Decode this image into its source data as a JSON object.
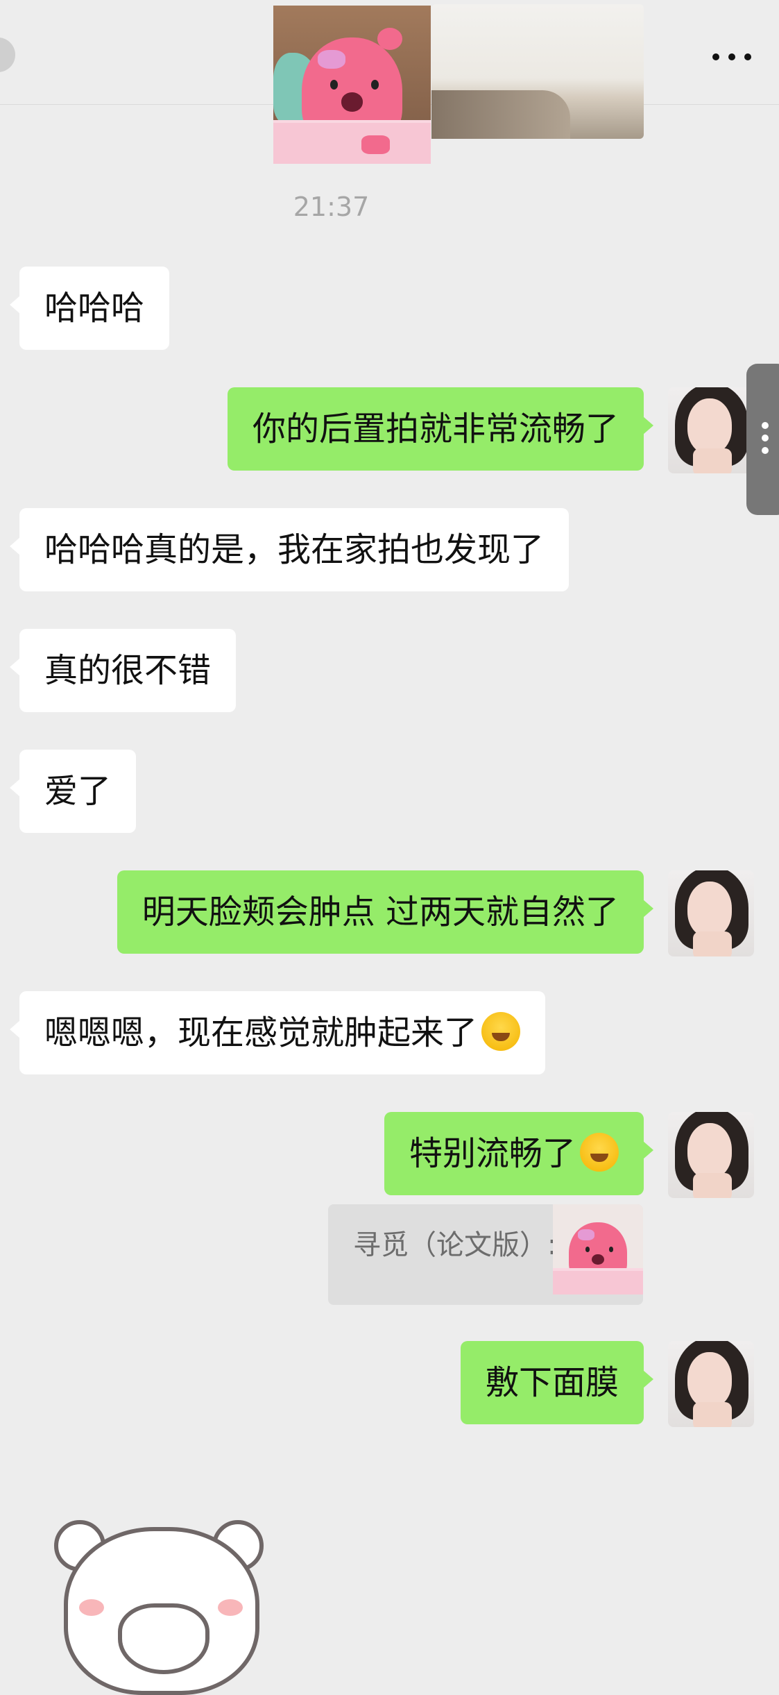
{
  "timestamp": "21:37",
  "messages": [
    {
      "side": "in",
      "text": "哈哈哈"
    },
    {
      "side": "out",
      "text": "你的后置拍就非常流畅了"
    },
    {
      "side": "in",
      "text": "哈哈哈真的是，我在家拍也发现了"
    },
    {
      "side": "in",
      "text": "真的很不错"
    },
    {
      "side": "in",
      "text": "爱了"
    },
    {
      "side": "out",
      "text": "明天脸颊会肿点 过两天就自然了"
    },
    {
      "side": "in",
      "text": "嗯嗯嗯，现在感觉就肿起来了",
      "emoji": "face-holding-back-tears"
    },
    {
      "side": "out",
      "text": "特别流畅了",
      "emoji": "face-with-hand-over-mouth"
    },
    {
      "side": "out",
      "text": "敷下面膜"
    }
  ],
  "quote": {
    "label": "寻觅（论文版）:",
    "thumb": "pink-beaver-sticker"
  },
  "icons": {
    "more": "more-dots-icon",
    "back": "back-icon"
  },
  "colors": {
    "background": "#ededed",
    "out_bubble": "#95ec69",
    "in_bubble": "#ffffff"
  }
}
